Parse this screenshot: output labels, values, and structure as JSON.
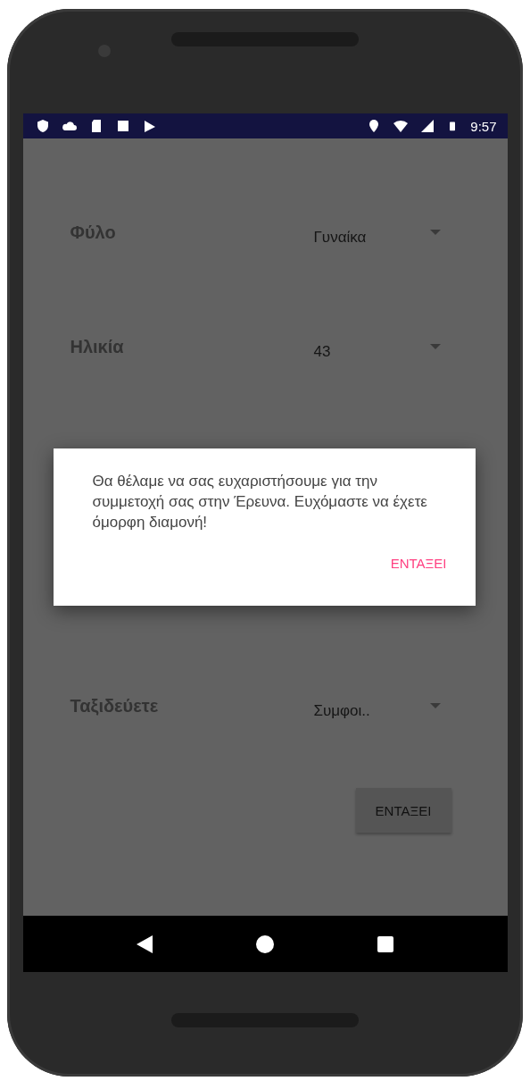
{
  "status_bar": {
    "time": "9:57"
  },
  "form": {
    "rows": [
      {
        "label": "Φύλο",
        "value": "Γυναίκα"
      },
      {
        "label": "Ηλικία",
        "value": "43"
      },
      {
        "label": "Ταξιδεύετε",
        "value": "Συμφοι.."
      }
    ],
    "button": "ENTAΞΕΙ"
  },
  "dialog": {
    "message": "Θα θέλαμε να σας ευχαριστήσουμε για την συμμετοχή σας στην Έρευνα. Ευχόμαστε να έχετε όμορφη διαμονή!",
    "button": "ENTAΞΕΙ"
  }
}
